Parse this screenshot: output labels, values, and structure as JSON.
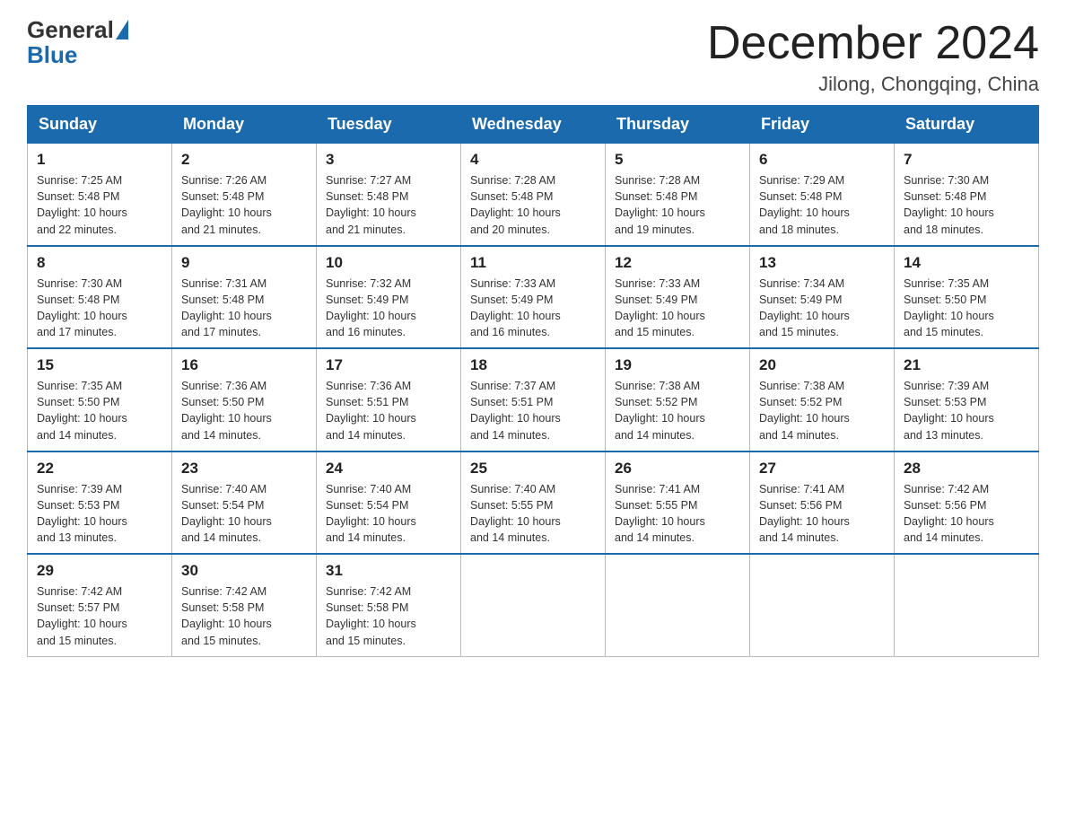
{
  "logo": {
    "general": "General",
    "blue": "Blue"
  },
  "title": "December 2024",
  "location": "Jilong, Chongqing, China",
  "headers": [
    "Sunday",
    "Monday",
    "Tuesday",
    "Wednesday",
    "Thursday",
    "Friday",
    "Saturday"
  ],
  "weeks": [
    [
      {
        "day": "1",
        "sunrise": "7:25 AM",
        "sunset": "5:48 PM",
        "daylight": "10 hours and 22 minutes."
      },
      {
        "day": "2",
        "sunrise": "7:26 AM",
        "sunset": "5:48 PM",
        "daylight": "10 hours and 21 minutes."
      },
      {
        "day": "3",
        "sunrise": "7:27 AM",
        "sunset": "5:48 PM",
        "daylight": "10 hours and 21 minutes."
      },
      {
        "day": "4",
        "sunrise": "7:28 AM",
        "sunset": "5:48 PM",
        "daylight": "10 hours and 20 minutes."
      },
      {
        "day": "5",
        "sunrise": "7:28 AM",
        "sunset": "5:48 PM",
        "daylight": "10 hours and 19 minutes."
      },
      {
        "day": "6",
        "sunrise": "7:29 AM",
        "sunset": "5:48 PM",
        "daylight": "10 hours and 18 minutes."
      },
      {
        "day": "7",
        "sunrise": "7:30 AM",
        "sunset": "5:48 PM",
        "daylight": "10 hours and 18 minutes."
      }
    ],
    [
      {
        "day": "8",
        "sunrise": "7:30 AM",
        "sunset": "5:48 PM",
        "daylight": "10 hours and 17 minutes."
      },
      {
        "day": "9",
        "sunrise": "7:31 AM",
        "sunset": "5:48 PM",
        "daylight": "10 hours and 17 minutes."
      },
      {
        "day": "10",
        "sunrise": "7:32 AM",
        "sunset": "5:49 PM",
        "daylight": "10 hours and 16 minutes."
      },
      {
        "day": "11",
        "sunrise": "7:33 AM",
        "sunset": "5:49 PM",
        "daylight": "10 hours and 16 minutes."
      },
      {
        "day": "12",
        "sunrise": "7:33 AM",
        "sunset": "5:49 PM",
        "daylight": "10 hours and 15 minutes."
      },
      {
        "day": "13",
        "sunrise": "7:34 AM",
        "sunset": "5:49 PM",
        "daylight": "10 hours and 15 minutes."
      },
      {
        "day": "14",
        "sunrise": "7:35 AM",
        "sunset": "5:50 PM",
        "daylight": "10 hours and 15 minutes."
      }
    ],
    [
      {
        "day": "15",
        "sunrise": "7:35 AM",
        "sunset": "5:50 PM",
        "daylight": "10 hours and 14 minutes."
      },
      {
        "day": "16",
        "sunrise": "7:36 AM",
        "sunset": "5:50 PM",
        "daylight": "10 hours and 14 minutes."
      },
      {
        "day": "17",
        "sunrise": "7:36 AM",
        "sunset": "5:51 PM",
        "daylight": "10 hours and 14 minutes."
      },
      {
        "day": "18",
        "sunrise": "7:37 AM",
        "sunset": "5:51 PM",
        "daylight": "10 hours and 14 minutes."
      },
      {
        "day": "19",
        "sunrise": "7:38 AM",
        "sunset": "5:52 PM",
        "daylight": "10 hours and 14 minutes."
      },
      {
        "day": "20",
        "sunrise": "7:38 AM",
        "sunset": "5:52 PM",
        "daylight": "10 hours and 14 minutes."
      },
      {
        "day": "21",
        "sunrise": "7:39 AM",
        "sunset": "5:53 PM",
        "daylight": "10 hours and 13 minutes."
      }
    ],
    [
      {
        "day": "22",
        "sunrise": "7:39 AM",
        "sunset": "5:53 PM",
        "daylight": "10 hours and 13 minutes."
      },
      {
        "day": "23",
        "sunrise": "7:40 AM",
        "sunset": "5:54 PM",
        "daylight": "10 hours and 14 minutes."
      },
      {
        "day": "24",
        "sunrise": "7:40 AM",
        "sunset": "5:54 PM",
        "daylight": "10 hours and 14 minutes."
      },
      {
        "day": "25",
        "sunrise": "7:40 AM",
        "sunset": "5:55 PM",
        "daylight": "10 hours and 14 minutes."
      },
      {
        "day": "26",
        "sunrise": "7:41 AM",
        "sunset": "5:55 PM",
        "daylight": "10 hours and 14 minutes."
      },
      {
        "day": "27",
        "sunrise": "7:41 AM",
        "sunset": "5:56 PM",
        "daylight": "10 hours and 14 minutes."
      },
      {
        "day": "28",
        "sunrise": "7:42 AM",
        "sunset": "5:56 PM",
        "daylight": "10 hours and 14 minutes."
      }
    ],
    [
      {
        "day": "29",
        "sunrise": "7:42 AM",
        "sunset": "5:57 PM",
        "daylight": "10 hours and 15 minutes."
      },
      {
        "day": "30",
        "sunrise": "7:42 AM",
        "sunset": "5:58 PM",
        "daylight": "10 hours and 15 minutes."
      },
      {
        "day": "31",
        "sunrise": "7:42 AM",
        "sunset": "5:58 PM",
        "daylight": "10 hours and 15 minutes."
      },
      null,
      null,
      null,
      null
    ]
  ],
  "labels": {
    "sunrise": "Sunrise:",
    "sunset": "Sunset:",
    "daylight": "Daylight:"
  }
}
